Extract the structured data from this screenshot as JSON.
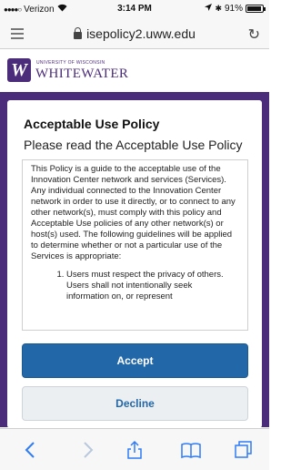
{
  "status_bar": {
    "carrier": "Verizon",
    "time": "3:14 PM",
    "battery": "91%",
    "battery_level": 0.91
  },
  "browser": {
    "url": "isepolicy2.uww.edu"
  },
  "header": {
    "logo_small_text": "UNIVERSITY OF WISCONSIN",
    "logo_big_text": "WHITEWATER",
    "logo_mark": "W"
  },
  "policy": {
    "title": "Acceptable Use Policy",
    "subtitle": "Please read the Acceptable Use Policy",
    "paragraph": "This Policy is a guide to the acceptable use of the Innovation Center network and services (Services). Any individual connected to the Innovation Center  network in order to use it directly, or to connect to any other network(s), must comply with this policy and Acceptable Use policies of any other network(s) or host(s) used. The following guidelines will be applied to determine whether or not a particular use of the Services is appropriate:",
    "list_item_1": "Users must respect the privacy of others. Users shall not intentionally seek information on, or represent"
  },
  "buttons": {
    "accept": "Accept",
    "decline": "Decline"
  },
  "colors": {
    "brand_purple": "#4b2c7a",
    "accept_blue": "#2268a8",
    "ios_blue": "#2f7cf6"
  },
  "toolbar": {
    "icons": [
      "back-icon",
      "forward-icon",
      "share-icon",
      "bookmarks-icon",
      "tabs-icon"
    ]
  }
}
